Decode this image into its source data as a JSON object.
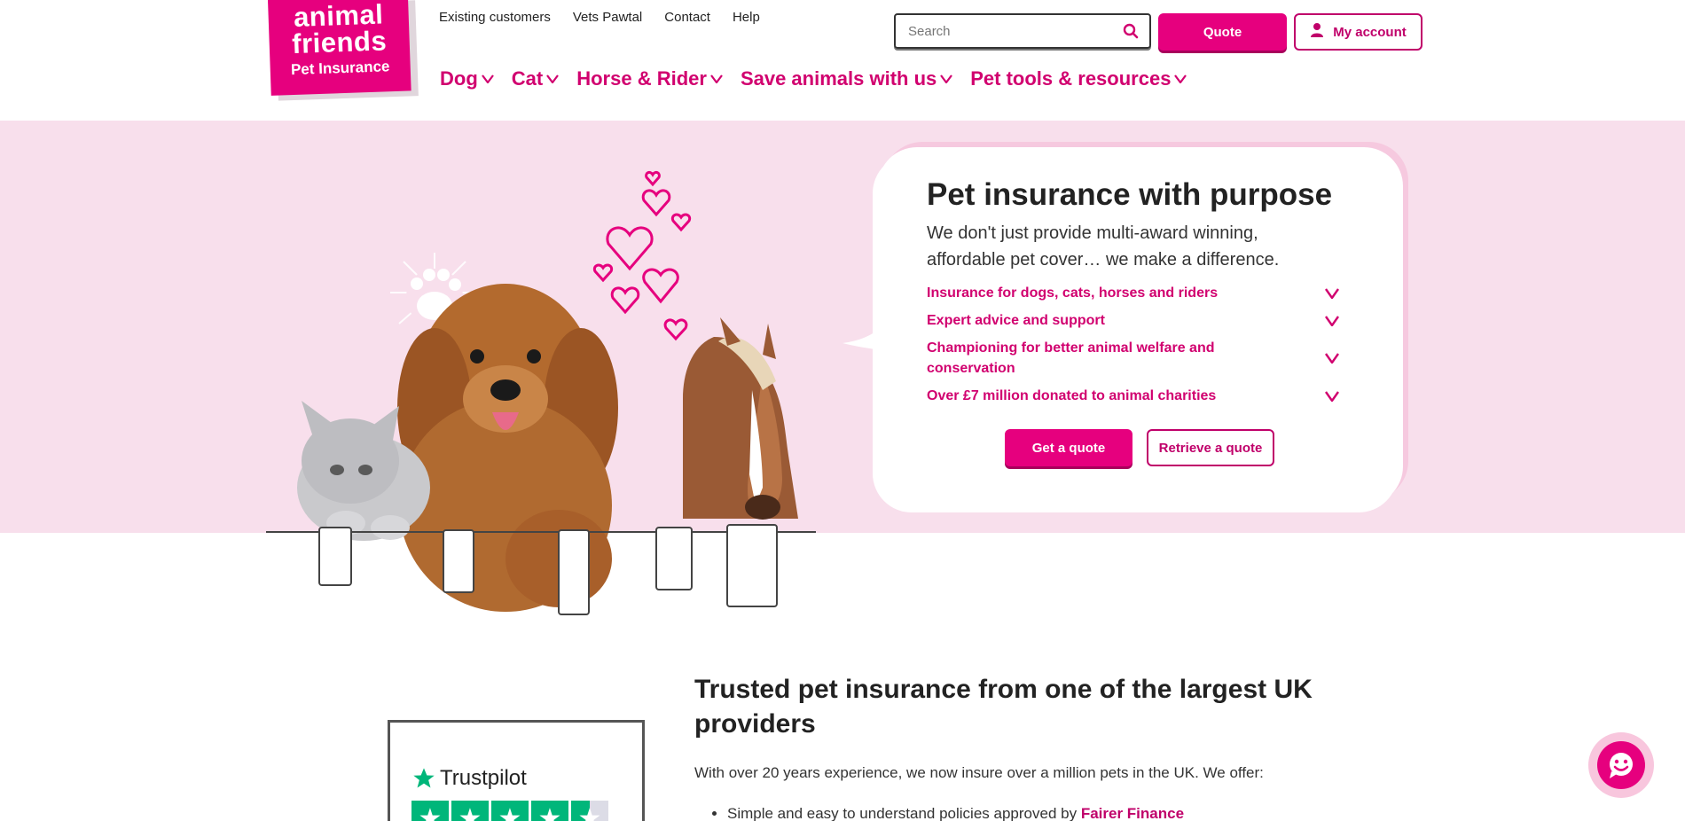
{
  "brand": {
    "logo_line1": "animal friends",
    "logo_line2": "Pet Insurance",
    "accent": "#e6007e",
    "hero_bg": "#f8dfec"
  },
  "topnav": {
    "items": [
      {
        "label": "Existing customers"
      },
      {
        "label": "Vets Pawtal"
      },
      {
        "label": "Contact"
      },
      {
        "label": "Help"
      }
    ]
  },
  "search": {
    "placeholder": "Search",
    "icon": "search-icon"
  },
  "header_buttons": {
    "quote_label": "Quote",
    "account_label": "My account",
    "account_icon": "user-icon"
  },
  "mainnav": {
    "items": [
      {
        "label": "Dog"
      },
      {
        "label": "Cat"
      },
      {
        "label": "Horse & Rider"
      },
      {
        "label": "Save animals with us"
      },
      {
        "label": "Pet tools & resources"
      }
    ]
  },
  "hero": {
    "title": "Pet insurance with purpose",
    "subtitle": "We don't just provide multi-award winning, affordable pet cover… we make a difference.",
    "features": [
      {
        "label": "Insurance for dogs, cats, horses and riders"
      },
      {
        "label": "Expert advice and support"
      },
      {
        "label": "Championing for better animal welfare and conservation"
      },
      {
        "label": "Over £7 million donated to animal charities"
      }
    ],
    "get_quote_label": "Get a quote",
    "retrieve_quote_label": "Retrieve a quote"
  },
  "trust": {
    "trustpilot_label": "Trustpilot",
    "stars_filled": 4.5,
    "stars_total": 5
  },
  "section": {
    "title": "Trusted pet insurance from one of the largest UK providers",
    "intro": "With over 20 years experience, we now insure over a million pets in the UK. We offer:",
    "list_item_text": "Simple and easy to understand policies approved by",
    "list_item_link": "Fairer Finance"
  },
  "chat": {
    "icon": "chat-smiley-icon"
  }
}
